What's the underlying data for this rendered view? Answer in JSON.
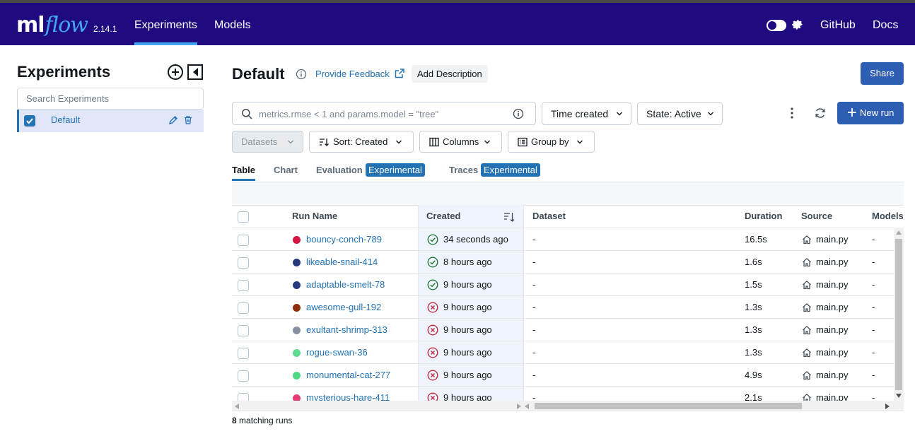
{
  "topbar": {
    "logo_ml": "ml",
    "logo_flow": "flow",
    "version": "2.14.1",
    "nav": [
      {
        "label": "Experiments",
        "active": true
      },
      {
        "label": "Models",
        "active": false
      }
    ],
    "links": [
      "GitHub",
      "Docs"
    ],
    "colors": {
      "bar": "#1f0a80",
      "accent": "#43a6f0"
    }
  },
  "sidebar": {
    "title": "Experiments",
    "search_placeholder": "Search Experiments",
    "experiments": [
      {
        "label": "Default",
        "checked": true
      }
    ]
  },
  "main": {
    "title": "Default",
    "feedback_link": "Provide Feedback",
    "add_description": "Add Description",
    "share": "Share",
    "search_placeholder": "metrics.rmse < 1 and params.model = \"tree\"",
    "time_filter": "Time created",
    "state_filter": "State: Active",
    "new_run": "New run",
    "datasets": "Datasets",
    "sort": "Sort: Created",
    "columns": "Columns",
    "group_by": "Group by",
    "tabs": [
      {
        "label": "Table",
        "active": true
      },
      {
        "label": "Chart",
        "active": false
      },
      {
        "label": "Evaluation",
        "badge": "Experimental"
      },
      {
        "label": "Traces",
        "badge": "Experimental"
      }
    ]
  },
  "table": {
    "headers": {
      "run_name": "Run Name",
      "created": "Created",
      "dataset": "Dataset",
      "duration": "Duration",
      "source": "Source",
      "models": "Models"
    },
    "rows": [
      {
        "name": "bouncy-conch-789",
        "color": "#d4153f",
        "status": "success",
        "created": "34 seconds ago",
        "dataset": "-",
        "duration": "16.5s",
        "source": "main.py",
        "models": "-"
      },
      {
        "name": "likeable-snail-414",
        "color": "#24387a",
        "status": "success",
        "created": "8 hours ago",
        "dataset": "-",
        "duration": "1.6s",
        "source": "main.py",
        "models": "-"
      },
      {
        "name": "adaptable-smelt-78",
        "color": "#263a80",
        "status": "success",
        "created": "9 hours ago",
        "dataset": "-",
        "duration": "1.5s",
        "source": "main.py",
        "models": "-"
      },
      {
        "name": "awesome-gull-192",
        "color": "#8e2c0e",
        "status": "failed",
        "created": "9 hours ago",
        "dataset": "-",
        "duration": "1.3s",
        "source": "main.py",
        "models": "-"
      },
      {
        "name": "exultant-shrimp-313",
        "color": "#8690a0",
        "status": "failed",
        "created": "9 hours ago",
        "dataset": "-",
        "duration": "1.3s",
        "source": "main.py",
        "models": "-"
      },
      {
        "name": "rogue-swan-36",
        "color": "#5fdb8f",
        "status": "failed",
        "created": "9 hours ago",
        "dataset": "-",
        "duration": "1.3s",
        "source": "main.py",
        "models": "-"
      },
      {
        "name": "monumental-cat-277",
        "color": "#4fd987",
        "status": "failed",
        "created": "9 hours ago",
        "dataset": "-",
        "duration": "4.9s",
        "source": "main.py",
        "models": "-"
      },
      {
        "name": "mysterious-hare-411",
        "color": "#e83d72",
        "status": "failed",
        "created": "9 hours ago",
        "dataset": "-",
        "duration": "2.1s",
        "source": "main.py",
        "models": "-"
      }
    ],
    "status_colors": {
      "success": "#277c43",
      "failed": "#c82d4c"
    }
  },
  "footer": {
    "count": "8",
    "label": "matching runs"
  }
}
